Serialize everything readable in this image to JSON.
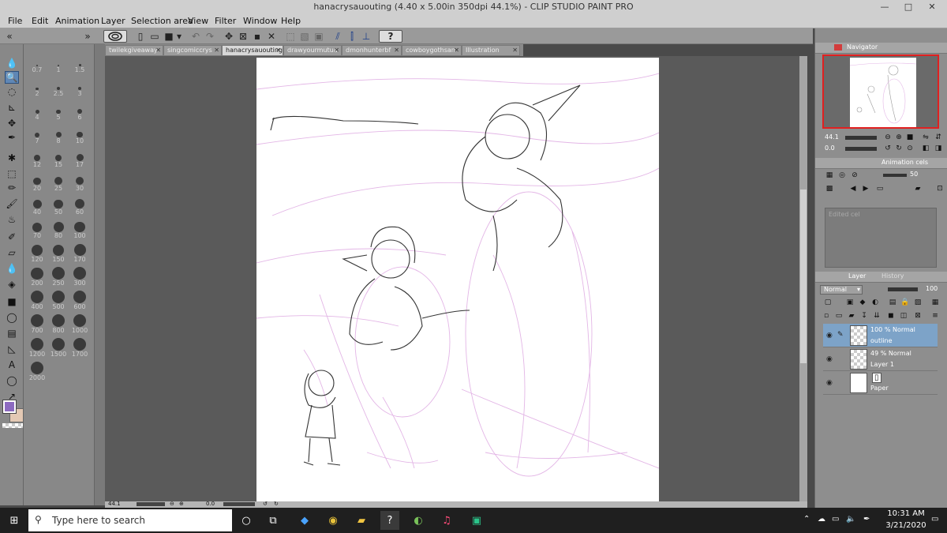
{
  "window": {
    "title": "hanacrysauouting (4.40 x 5.00in 350dpi 44.1%)  - CLIP STUDIO PAINT PRO",
    "controls": [
      "—",
      "□",
      "✕"
    ]
  },
  "menu": [
    "File",
    "Edit",
    "Animation",
    "Layer",
    "Selection area",
    "View",
    "Filter",
    "Window",
    "Help"
  ],
  "tabs": [
    {
      "label": "twilekgiveaway"
    },
    {
      "label": "singcomiccrys"
    },
    {
      "label": "hanacrysauouting"
    },
    {
      "label": "drawyourmutua"
    },
    {
      "label": "dmonhunterbf"
    },
    {
      "label": "cowboygothsan"
    },
    {
      "label": "Illustration"
    }
  ],
  "active_tab_index": 2,
  "brush_sizes": [
    "0.7",
    "1",
    "1.5",
    "2",
    "2.5",
    "3",
    "4",
    "5",
    "6",
    "7",
    "8",
    "10",
    "12",
    "15",
    "17",
    "20",
    "25",
    "30",
    "40",
    "50",
    "60",
    "70",
    "80",
    "100",
    "120",
    "150",
    "170",
    "200",
    "250",
    "300",
    "400",
    "500",
    "600",
    "700",
    "800",
    "1000",
    "1200",
    "1500",
    "1700",
    "2000"
  ],
  "colors": {
    "main": "#8c6ac0",
    "sub": "#e4c9b4",
    "accent": "#5f87b6"
  },
  "navigator": {
    "title": "Navigator",
    "zoom": "44.1",
    "angle": "0.0"
  },
  "animation_cels": {
    "title": "Animation cels",
    "value": "50",
    "empty_label": "Edited cel"
  },
  "layer_panel": {
    "tabs": [
      "Layer",
      "History"
    ],
    "blend_mode": "Normal",
    "opacity": "100",
    "layers": [
      {
        "line1": "100 % Normal",
        "line2": "outline",
        "selected": true
      },
      {
        "line1": "49 % Normal",
        "line2": "Layer 1",
        "selected": false
      },
      {
        "line1": "",
        "line2": "Paper",
        "selected": false
      }
    ]
  },
  "status": {
    "zoom": "44.1",
    "angle": "0.0"
  },
  "taskbar": {
    "search_placeholder": "Type here to search",
    "time": "10:31 AM",
    "date": "3/21/2020"
  }
}
